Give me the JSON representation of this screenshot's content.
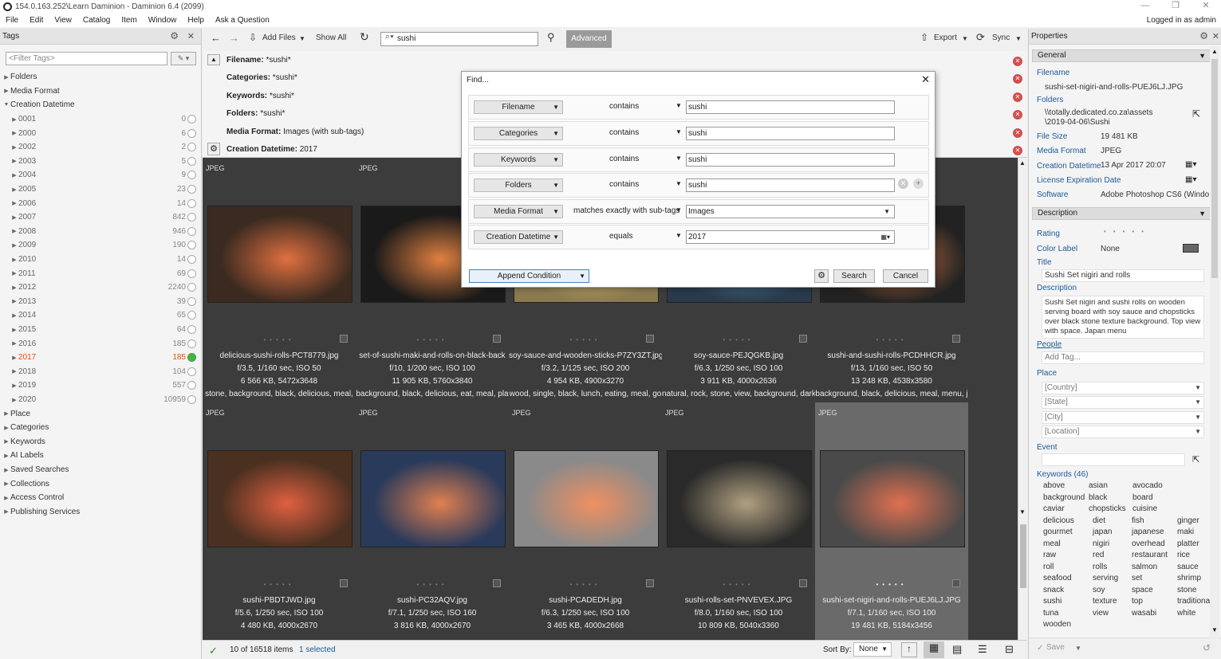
{
  "window": {
    "title": "154.0.163.252\\Learn Daminion - Daminion 6.4 (2099)",
    "logged_in": "Logged in as admin",
    "controls": [
      "—",
      "❐",
      "✕"
    ]
  },
  "menu": [
    "File",
    "Edit",
    "View",
    "Catalog",
    "Item",
    "Window",
    "Help",
    "Ask a Question"
  ],
  "tags_panel": {
    "title": "Tags",
    "filter_placeholder": "<Filter Tags>",
    "top_items": [
      "Folders",
      "Media Format",
      "Creation Datetime"
    ],
    "years": [
      {
        "label": "0001",
        "count": "0"
      },
      {
        "label": "2000",
        "count": "6"
      },
      {
        "label": "2002",
        "count": "2"
      },
      {
        "label": "2003",
        "count": "5"
      },
      {
        "label": "2004",
        "count": "9"
      },
      {
        "label": "2005",
        "count": "23"
      },
      {
        "label": "2006",
        "count": "14"
      },
      {
        "label": "2007",
        "count": "842"
      },
      {
        "label": "2008",
        "count": "946"
      },
      {
        "label": "2009",
        "count": "190"
      },
      {
        "label": "2010",
        "count": "14"
      },
      {
        "label": "2011",
        "count": "69"
      },
      {
        "label": "2012",
        "count": "2240"
      },
      {
        "label": "2013",
        "count": "39"
      },
      {
        "label": "2014",
        "count": "65"
      },
      {
        "label": "2015",
        "count": "64"
      },
      {
        "label": "2016",
        "count": "185"
      },
      {
        "label": "2017",
        "count": "185"
      },
      {
        "label": "2018",
        "count": "104"
      },
      {
        "label": "2019",
        "count": "557"
      },
      {
        "label": "2020",
        "count": "10959"
      }
    ],
    "bottom_items": [
      "Place",
      "Categories",
      "Keywords",
      "AI Labels",
      "Saved Searches",
      "Collections",
      "Access Control",
      "Publishing Services"
    ]
  },
  "toolbar": {
    "add_files": "Add Files",
    "show_all": "Show All",
    "search_value": "sushi",
    "advanced": "Advanced",
    "export": "Export",
    "sync": "Sync"
  },
  "criteria": [
    {
      "label": "Filename:",
      "value": "*sushi*"
    },
    {
      "label": "Categories:",
      "value": "*sushi*"
    },
    {
      "label": "Keywords:",
      "value": "*sushi*"
    },
    {
      "label": "Folders:",
      "value": "*sushi*"
    },
    {
      "label": "Media Format:",
      "value": "Images (with sub-tags)"
    },
    {
      "label": "Creation Datetime:",
      "value": "2017"
    }
  ],
  "find_dialog": {
    "title": "Find...",
    "rows": [
      {
        "field": "Filename",
        "op": "contains",
        "value": "sushi"
      },
      {
        "field": "Categories",
        "op": "contains",
        "value": "sushi"
      },
      {
        "field": "Keywords",
        "op": "contains",
        "value": "sushi"
      },
      {
        "field": "Folders",
        "op": "contains",
        "value": "sushi"
      },
      {
        "field": "Media Format",
        "op": "matches exactly with sub-tags",
        "value": "Images"
      },
      {
        "field": "Creation Datetime",
        "op": "equals",
        "value": "2017"
      }
    ],
    "append_condition": "Append Condition",
    "search": "Search",
    "cancel": "Cancel"
  },
  "grid": {
    "items": [
      {
        "type": "JPEG",
        "name": "delicious-sushi-rolls-PCT8779.jpg",
        "exif": "f/3.5, 1/160 sec, ISO 50",
        "size": "6 566 KB, 5472x3648",
        "tags": "stone, background, black, delicious, meal,",
        "bg": "#3a2a20",
        "accent": "#e07040"
      },
      {
        "type": "JPEG",
        "name": "set-of-sushi-maki-and-rolls-on-black-back",
        "exif": "f/10, 1/200 sec, ISO 100",
        "size": "11 905 KB, 5760x3840",
        "tags": "background, black, delicious, eat, meal, pla",
        "bg": "#1a1a1a",
        "accent": "#e08040"
      },
      {
        "type": "JPEG",
        "name": "soy-sauce-and-wooden-sticks-P7ZY3ZT.jpg",
        "exif": "f/3.2, 1/125 sec, ISO 200",
        "size": "4 954 KB, 4900x3270",
        "tags": "wood, single, black, lunch, eating, meal, go",
        "bg": "#8a7a50",
        "accent": "#c8b070"
      },
      {
        "type": "JPEG",
        "name": "soy-sauce-PEJQGKB.jpg",
        "exif": "f/6.3, 1/250 sec, ISO 100",
        "size": "3 911 KB, 4000x2636",
        "tags": "natural, rock, stone, view, background, dark",
        "bg": "#2a3a4a",
        "accent": "#5080a0"
      },
      {
        "type": "JPEG",
        "name": "sushi-and-sushi-rolls-PCDHHCR.jpg",
        "exif": "f/13, 1/160 sec, ISO 50",
        "size": "13 248 KB, 4538x3580",
        "tags": "background, black, delicious, meal, menu, j",
        "bg": "#222222",
        "accent": "#c07040"
      },
      {
        "type": "JPEG",
        "name": "sushi-PBDTJWD.jpg",
        "exif": "f/5.6, 1/250 sec, ISO 100",
        "size": "4 480 KB, 4000x2670",
        "tags": "",
        "bg": "#4a3020",
        "accent": "#e06040"
      },
      {
        "type": "JPEG",
        "name": "sushi-PC32AQV.jpg",
        "exif": "f/7.1, 1/250 sec, ISO 160",
        "size": "3 816 KB, 4000x2670",
        "tags": "",
        "bg": "#2a3a5a",
        "accent": "#e08050"
      },
      {
        "type": "JPEG",
        "name": "sushi-PCADEDH.jpg",
        "exif": "f/6.3, 1/250 sec, ISO 100",
        "size": "3 465 KB, 4000x2668",
        "tags": "",
        "bg": "#8a8a8a",
        "accent": "#f09060"
      },
      {
        "type": "JPEG",
        "name": "sushi-rolls-set-PNVEVEX.JPG",
        "exif": "f/8.0, 1/160 sec, ISO 100",
        "size": "10 809 KB, 5040x3360",
        "tags": "",
        "bg": "#2a2a2a",
        "accent": "#b0a080"
      },
      {
        "type": "JPEG",
        "name": "sushi-set-nigiri-and-rolls-PUEJ6LJ.JPG",
        "exif": "f/7.1, 1/160 sec, ISO 100",
        "size": "19 481 KB, 5184x3456",
        "tags": "",
        "bg": "#4a4a4a",
        "accent": "#e07050"
      }
    ]
  },
  "status": {
    "items": "10 of 16518 items",
    "selected": "1 selected",
    "sort_by": "Sort By:",
    "sort_value": "None"
  },
  "properties": {
    "title": "Properties",
    "general": "General",
    "filename_label": "Filename",
    "filename": "sushi-set-nigiri-and-rolls-PUEJ6LJ.JPG",
    "folders_label": "Folders",
    "folders_1": "\\\\totally.dedicated.co.za\\assets",
    "folders_2": "\\2019-04-06\\Sushi",
    "filesize_label": "File Size",
    "filesize": "19 481 KB",
    "mediaformat_label": "Media Format",
    "mediaformat": "JPEG",
    "creation_label": "Creation Datetime",
    "creation": "13  Apr  2017   20:07",
    "license_label": "License Expiration Date",
    "software_label": "Software",
    "software": "Adobe Photoshop CS6 (Windo",
    "description_section": "Description",
    "rating_label": "Rating",
    "colorlabel_label": "Color Label",
    "colorlabel": "None",
    "title_label": "Title",
    "title_value": "Sushi Set nigiri and rolls",
    "description_label": "Description",
    "description_value": "Sushi Set nigiri and sushi rolls on wooden serving board with soy sauce and chopsticks over black stone texture background. Top view with space. Japan menu",
    "people_label": "People",
    "add_tag": "Add Tag...",
    "place_label": "Place",
    "country": "[Country]",
    "state": "[State]",
    "city": "[City]",
    "location": "[Location]",
    "event_label": "Event",
    "keywords_label": "Keywords (46)",
    "keywords": [
      [
        "above",
        "asian",
        "avocado"
      ],
      [
        "background",
        "black",
        "board"
      ],
      [
        "caviar",
        "chopsticks",
        "cuisine"
      ],
      [
        "delicious",
        "diet",
        "fish",
        "ginger"
      ],
      [
        "gourmet",
        "japan",
        "japanese",
        "maki"
      ],
      [
        "meal",
        "nigiri",
        "overhead",
        "platter"
      ],
      [
        "raw",
        "red",
        "restaurant",
        "rice"
      ],
      [
        "roll",
        "rolls",
        "salmon",
        "sauce"
      ],
      [
        "seafood",
        "serving",
        "set",
        "shrimp"
      ],
      [
        "snack",
        "soy",
        "space",
        "stone"
      ],
      [
        "sushi",
        "texture",
        "top",
        "traditional"
      ],
      [
        "tuna",
        "view",
        "wasabi",
        "white"
      ],
      [
        "wooden"
      ]
    ],
    "save": "Save"
  },
  "colors": {
    "accent_orange": "#e05010",
    "grid_bg": "#3c3c3c",
    "link_blue": "#1a5a9a"
  }
}
